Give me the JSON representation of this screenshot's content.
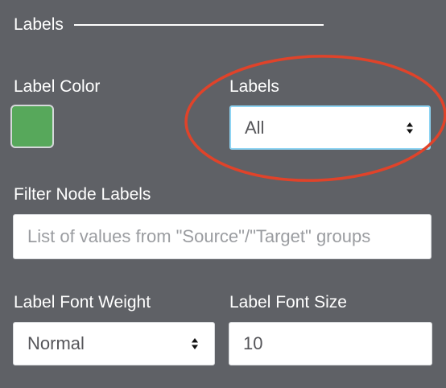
{
  "section": {
    "title": "Labels"
  },
  "label_color": {
    "label": "Label Color",
    "color": "#57a85b"
  },
  "labels": {
    "label": "Labels",
    "selected": "All"
  },
  "filter": {
    "label": "Filter Node Labels",
    "placeholder": "List of values from \"Source\"/\"Target\" groups",
    "value": ""
  },
  "font_weight": {
    "label": "Label Font Weight",
    "selected": "Normal"
  },
  "font_size": {
    "label": "Label Font Size",
    "value": "10"
  },
  "icons": {
    "select_arrows": "up-down-arrows-icon"
  },
  "colors": {
    "panel_background": "#5f6166",
    "annotation": "#e0432a",
    "focus_border": "#8ed4f3"
  }
}
